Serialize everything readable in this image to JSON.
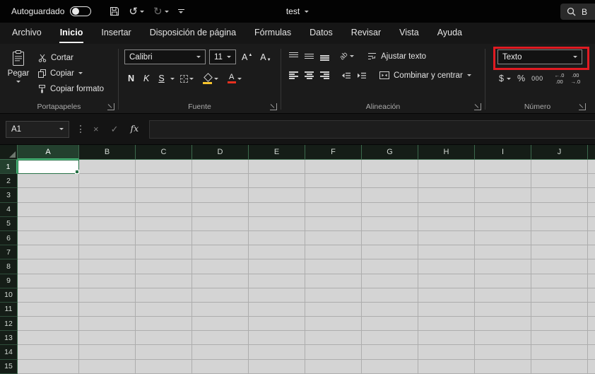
{
  "titlebar": {
    "autosave_label": "Autoguardado",
    "doc_title": "test",
    "search_text": "B"
  },
  "icons": {
    "undo_glyph": "↺",
    "redo_glyph": "↻",
    "cancel_glyph": "×",
    "enter_glyph": "✓"
  },
  "ribbon_tabs": [
    {
      "label": "Archivo",
      "active": false
    },
    {
      "label": "Inicio",
      "active": true
    },
    {
      "label": "Insertar",
      "active": false
    },
    {
      "label": "Disposición de página",
      "active": false
    },
    {
      "label": "Fórmulas",
      "active": false
    },
    {
      "label": "Datos",
      "active": false
    },
    {
      "label": "Revisar",
      "active": false
    },
    {
      "label": "Vista",
      "active": false
    },
    {
      "label": "Ayuda",
      "active": false
    }
  ],
  "clipboard": {
    "paste_label": "Pegar",
    "cut_label": "Cortar",
    "copy_label": "Copiar",
    "format_painter_label": "Copiar formato",
    "group_label": "Portapapeles"
  },
  "font": {
    "family_value": "Calibri",
    "size_value": "11",
    "grow_label": "A",
    "shrink_label": "A",
    "bold_label": "N",
    "italic_label": "K",
    "underline_label": "S",
    "group_label": "Fuente"
  },
  "alignment": {
    "orientation_icon_text": "ab",
    "wrap_label": "Ajustar texto",
    "wrap_icon_text": "ab",
    "merge_label": "Combinar y centrar",
    "group_label": "Alineación"
  },
  "number": {
    "format_value": "Texto",
    "currency_label": "$",
    "percent_label": "%",
    "thousands_label": "000",
    "increase_decimal": {
      "line1": "←.0",
      "line2": ".00"
    },
    "decrease_decimal": {
      "line1": ".00",
      "line2": "→.0"
    },
    "group_label": "Número"
  },
  "formula_bar": {
    "name_box_value": "A1",
    "fx_label": "fx",
    "formula_value": ""
  },
  "grid": {
    "selected_cell": "A1",
    "columns": [
      "A",
      "B",
      "C",
      "D",
      "E",
      "F",
      "G",
      "H",
      "I",
      "J"
    ],
    "rows": [
      "1",
      "2",
      "3",
      "4",
      "5",
      "6",
      "7",
      "8",
      "9",
      "10",
      "11",
      "12",
      "13",
      "14",
      "15"
    ]
  },
  "annotation": {
    "highlight_color": "#e11b22"
  }
}
